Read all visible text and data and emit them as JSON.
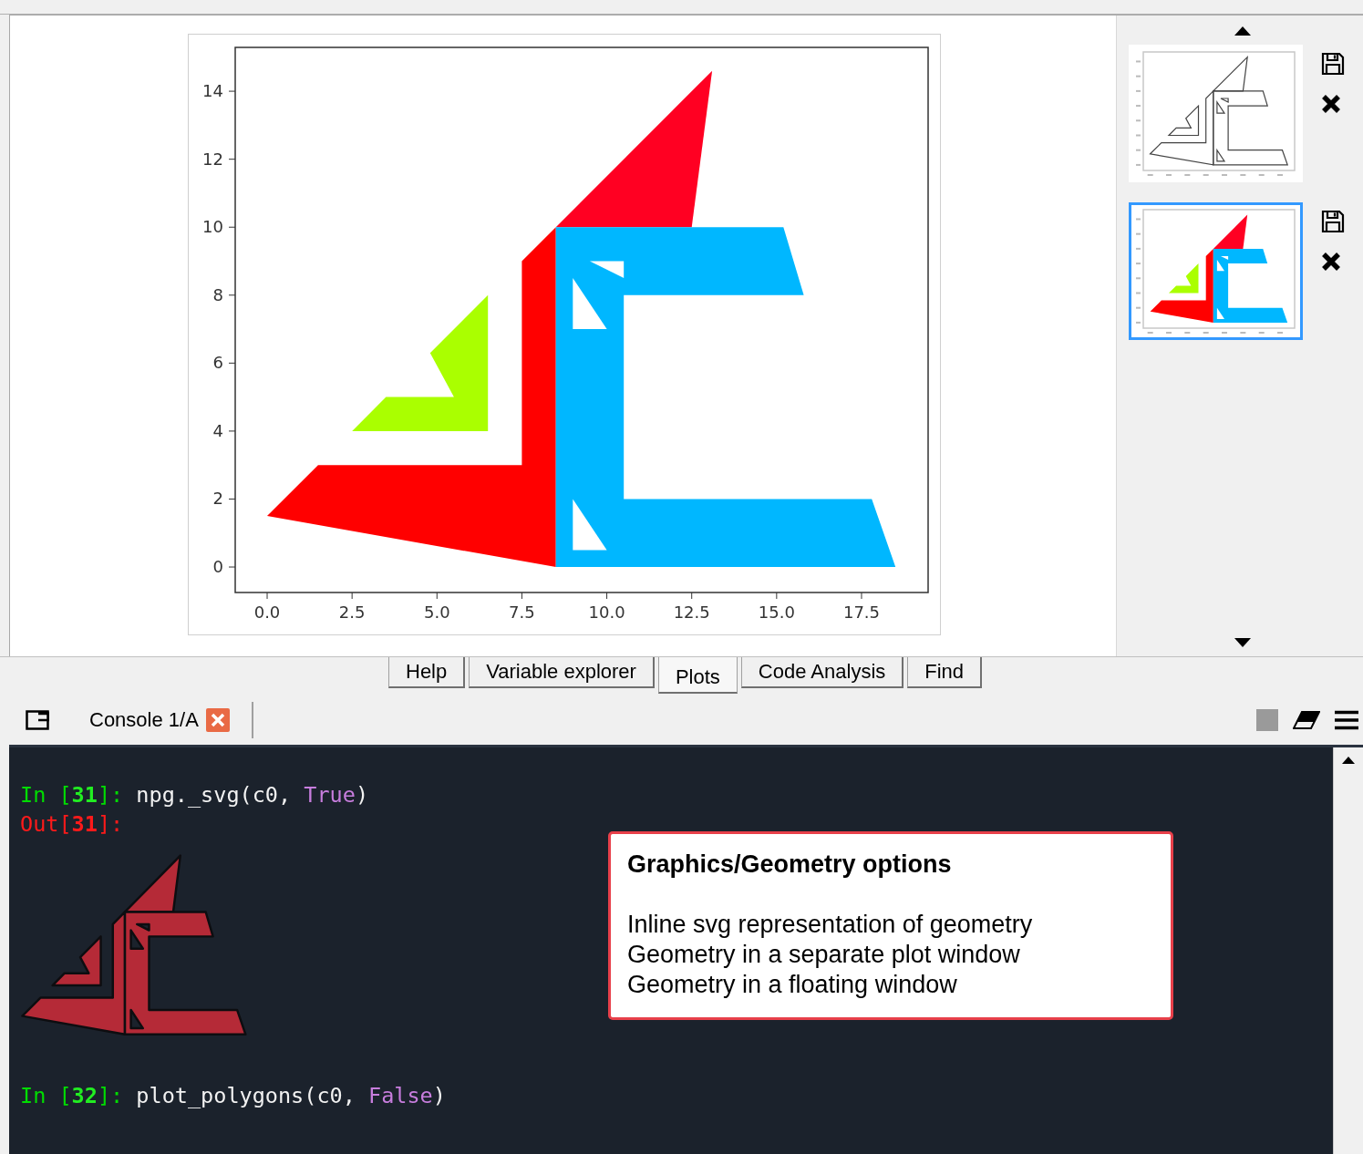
{
  "plots_pane": {
    "chart_data": {
      "type": "area",
      "xlim": [
        -0.94,
        19.46
      ],
      "ylim": [
        -0.75,
        15.29
      ],
      "xticks": [
        {
          "value": 0,
          "label": "0.0"
        },
        {
          "value": 2.5,
          "label": "2.5"
        },
        {
          "value": 5,
          "label": "5.0"
        },
        {
          "value": 7.5,
          "label": "7.5"
        },
        {
          "value": 10,
          "label": "10.0"
        },
        {
          "value": 12.5,
          "label": "12.5"
        },
        {
          "value": 15,
          "label": "15.0"
        },
        {
          "value": 17.5,
          "label": "17.5"
        }
      ],
      "yticks": [
        0,
        2,
        4,
        6,
        8,
        10,
        12,
        14
      ],
      "series": [
        {
          "color": "#ff0022",
          "x": [
            8.5,
            13.1,
            12.5
          ],
          "values": [
            10,
            14.6,
            10
          ]
        },
        {
          "color": "#ff0000",
          "x": [
            0,
            1.5,
            7.5,
            7.5,
            8.5,
            8.5
          ],
          "values": [
            1.5,
            3,
            3,
            9,
            10,
            0
          ]
        },
        {
          "color": "#aaff00",
          "x": [
            2.5,
            3.5,
            5.5,
            4.8,
            6.5,
            6.5
          ],
          "values": [
            4,
            5,
            5,
            6.3,
            8,
            4
          ]
        },
        {
          "color": "#00b7ff",
          "x": [
            8.5,
            18.5,
            17.8,
            10.5,
            10.5,
            15.8,
            15.2,
            8.5
          ],
          "values": [
            0,
            0,
            2,
            2,
            8,
            8,
            10,
            10
          ]
        },
        {
          "color": "#ffffff",
          "x": [
            9,
            9,
            10
          ],
          "values": [
            2,
            0.5,
            0.5
          ]
        },
        {
          "color": "#ffffff",
          "x": [
            9,
            9,
            10
          ],
          "values": [
            8.5,
            7,
            7
          ]
        },
        {
          "color": "#ffffff",
          "x": [
            9.5,
            10.5,
            10.5
          ],
          "values": [
            9,
            9,
            8.5
          ]
        }
      ]
    }
  },
  "thumbnails": [
    {
      "kind": "outline",
      "selected": false
    },
    {
      "kind": "filled",
      "selected": true
    }
  ],
  "tabs": [
    {
      "label": "Help",
      "selected": false
    },
    {
      "label": "Variable explorer",
      "selected": false
    },
    {
      "label": "Plots",
      "selected": true
    },
    {
      "label": "Code Analysis",
      "selected": false
    },
    {
      "label": "Find",
      "selected": false
    }
  ],
  "console_tab": {
    "label": "Console 1/A"
  },
  "console": {
    "entries": [
      {
        "kind": "code",
        "segments": [
          {
            "kind": "in",
            "text": "In ["
          },
          {
            "kind": "in-number",
            "text": "31"
          },
          {
            "kind": "in",
            "text": "]: "
          },
          {
            "kind": "code",
            "text": "npg._svg(c0, "
          },
          {
            "kind": "keyword",
            "text": "True"
          },
          {
            "kind": "code",
            "text": ")"
          }
        ]
      },
      {
        "kind": "code",
        "segments": [
          {
            "kind": "out",
            "text": "Out["
          },
          {
            "kind": "out-number",
            "text": "31"
          },
          {
            "kind": "out",
            "text": "]:"
          }
        ]
      },
      {
        "kind": "svg-output"
      },
      {
        "kind": "code",
        "segments": [
          {
            "kind": "in",
            "text": "In ["
          },
          {
            "kind": "in-number",
            "text": "32"
          },
          {
            "kind": "in",
            "text": "]: "
          },
          {
            "kind": "code",
            "text": "plot_polygons(c0, "
          },
          {
            "kind": "keyword",
            "text": "False"
          },
          {
            "kind": "code",
            "text": ")"
          }
        ]
      }
    ]
  },
  "callout": {
    "title": "Graphics/Geometry options",
    "lines": [
      "Inline svg representation of geometry",
      "Geometry in a separate plot window",
      "Geometry in a floating window"
    ]
  }
}
